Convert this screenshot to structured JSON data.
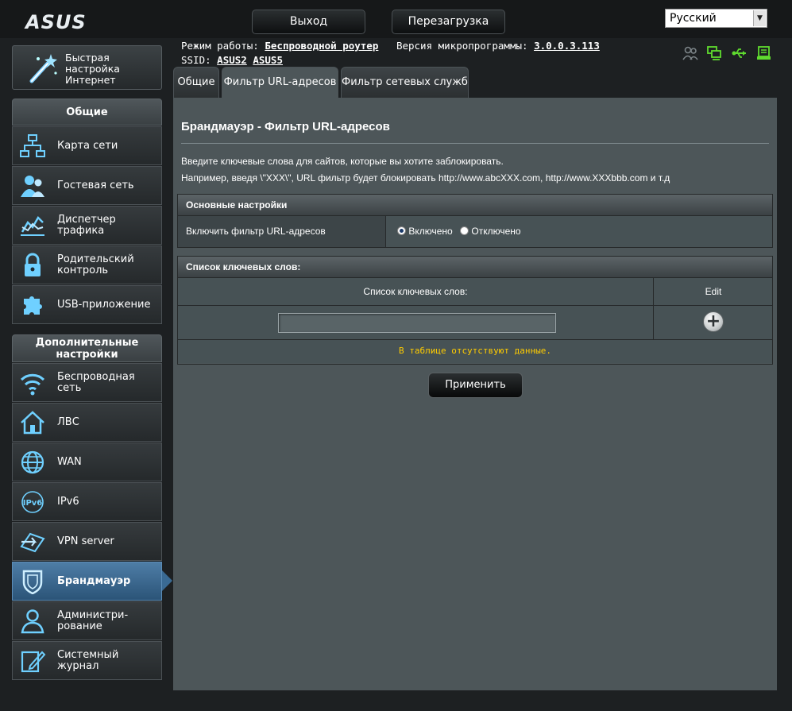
{
  "header": {
    "logo": "ASUS",
    "logout_label": "Выход",
    "reboot_label": "Перезагрузка",
    "language": "Русский"
  },
  "status": {
    "mode_label": "Режим работы:",
    "mode_value": "Беспроводной роутер",
    "fw_label": "Версия микропрограммы:",
    "fw_value": "3.0.0.3.113",
    "ssid_label": "SSID:",
    "ssid_1": "ASUS2",
    "ssid_2": "ASUS5",
    "icons": [
      "clients-icon",
      "network-status-icon",
      "usb-icon",
      "printer-icon"
    ]
  },
  "sidebar": {
    "quick": {
      "label": "Быстрая настройка Интернет",
      "icon": "magic-wand-icon"
    },
    "general_title": "Общие",
    "general_items": [
      {
        "label": "Карта сети",
        "icon": "network-map-icon"
      },
      {
        "label": "Гостевая сеть",
        "icon": "guest-network-icon"
      },
      {
        "label": "Диспетчер трафика",
        "icon": "traffic-manager-icon"
      },
      {
        "label": "Родительский контроль",
        "icon": "parental-control-icon"
      },
      {
        "label": "USB-приложение",
        "icon": "usb-app-icon"
      }
    ],
    "advanced_title": "Дополнительные настройки",
    "advanced_items": [
      {
        "label": "Беспроводная сеть",
        "icon": "wireless-icon"
      },
      {
        "label": "ЛВС",
        "icon": "lan-home-icon"
      },
      {
        "label": "WAN",
        "icon": "wan-globe-icon"
      },
      {
        "label": "IPv6",
        "icon": "ipv6-icon"
      },
      {
        "label": "VPN server",
        "icon": "vpn-icon"
      },
      {
        "label": "Брандмауэр",
        "icon": "firewall-shield-icon"
      },
      {
        "label": "Администри-рование",
        "icon": "admin-user-icon"
      },
      {
        "label": "Системный журнал",
        "icon": "system-log-icon"
      }
    ],
    "active_item": "Брандмауэр"
  },
  "tabs": [
    {
      "label": "Общие"
    },
    {
      "label": "Фильтр URL-адресов"
    },
    {
      "label": "Фильтр сетевых служб"
    }
  ],
  "main": {
    "title": "Брандмауэр - Фильтр URL-адресов",
    "desc_1": "Введите ключевые слова для сайтов, которые вы хотите заблокировать.",
    "desc_2": "Например, введя \\\"XXX\\\", URL фильтр будет блокировать http://www.abcXXX.com, http://www.XXXbbb.com и т.д",
    "basic": {
      "header": "Основные настройки",
      "enable_label": "Включить фильтр URL-адресов",
      "on_label": "Включено",
      "off_label": "Отключено",
      "selected": "on"
    },
    "keywords": {
      "header": "Список ключевых слов:",
      "col_keyword": "Список ключевых слов:",
      "col_edit": "Edit",
      "input_value": "",
      "empty_text": "В таблице отсутствуют данные."
    },
    "apply_label": "Применить"
  },
  "colors": {
    "accent_active": "#3a6a93",
    "panel_bg": "#4d5659",
    "empty_text": "#ffcc00"
  }
}
